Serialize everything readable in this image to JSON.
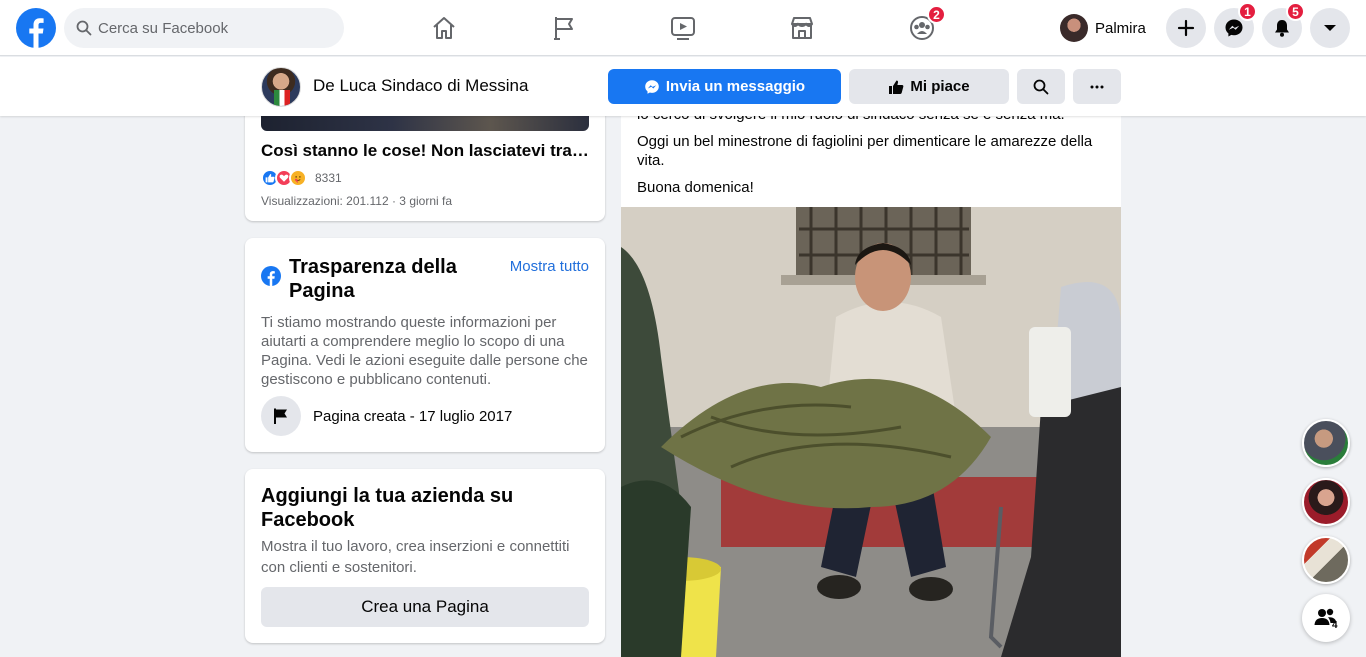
{
  "topbar": {
    "search_placeholder": "Cerca su Facebook",
    "nav": [
      {
        "icon": "home-icon"
      },
      {
        "icon": "pages-flag-icon"
      },
      {
        "icon": "watch-video-icon"
      },
      {
        "icon": "marketplace-icon"
      },
      {
        "icon": "groups-icon",
        "badge": "2"
      }
    ],
    "user_name": "Palmira",
    "messenger_badge": "1",
    "notifications_badge": "5",
    "brand_color": "#1877f2",
    "badge_color": "#e41e3f"
  },
  "page_bar": {
    "page_name": "De Luca Sindaco di Messina",
    "message_button": "Invia un messaggio",
    "like_button": "Mi piace"
  },
  "left_column": {
    "video": {
      "title": "Così stanno le cose! Non lasciatevi trascinare…",
      "reaction_count": "8331",
      "meta": "Visualizzazioni: 201.112 · 3 giorni fa"
    },
    "transparency": {
      "title": "Trasparenza della Pagina",
      "see_all": "Mostra tutto",
      "description": "Ti stiamo mostrando queste informazioni per aiutarti a comprendere meglio lo scopo di una Pagina. Vedi le azioni eseguite dalle persone che gestiscono e pubblicano contenuti.",
      "created": "Pagina creata - 17 luglio 2017"
    },
    "business": {
      "title": "Aggiungi la tua azienda su Facebook",
      "description": "Mostra il tuo lavoro, crea inserzioni e connettiti con clienti e sostenitori.",
      "button": "Crea una Pagina"
    }
  },
  "post": {
    "cut_line": "io cerco di svolgere il mio ruolo di sindaco senza se e senza ma.",
    "line1": "Oggi un bel minestrone di fagiolini per dimenticare le amarezze della vita.",
    "line2": "Buona domenica!"
  },
  "contacts": {
    "count": "4"
  }
}
